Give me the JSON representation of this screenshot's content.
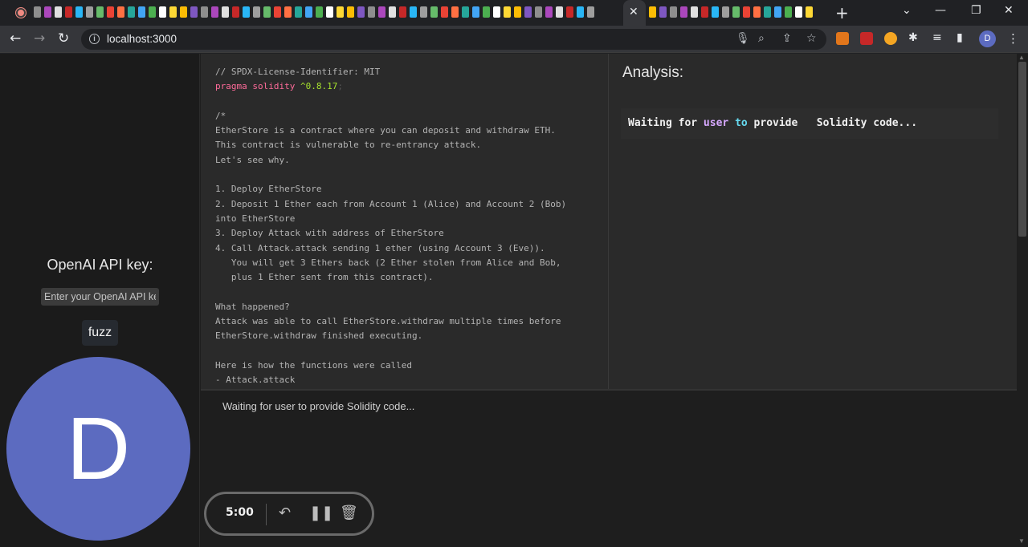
{
  "browser": {
    "url": "localhost:3000",
    "profile_initial": "D"
  },
  "sidebar": {
    "api_label": "OpenAI API key:",
    "api_placeholder": "Enter your OpenAI API key",
    "fuzz_label": "fuzz",
    "avatar_initial": "D"
  },
  "code": {
    "lines": [
      "// SPDX-License-Identifier: MIT",
      "__PRAGMA__",
      "",
      "/*",
      "EtherStore is a contract where you can deposit and withdraw ETH.",
      "This contract is vulnerable to re-entrancy attack.",
      "Let's see why.",
      "",
      "1. Deploy EtherStore",
      "2. Deposit 1 Ether each from Account 1 (Alice) and Account 2 (Bob)",
      "into EtherStore",
      "3. Deploy Attack with address of EtherStore",
      "4. Call Attack.attack sending 1 ether (using Account 3 (Eve)).",
      "   You will get 3 Ethers back (2 Ether stolen from Alice and Bob,",
      "   plus 1 Ether sent from this contract).",
      "",
      "What happened?",
      "Attack was able to call EtherStore.withdraw multiple times before",
      "EtherStore.withdraw finished executing.",
      "",
      "Here is how the functions were called",
      "- Attack.attack"
    ],
    "pragma_keyword": "pragma solidity",
    "pragma_version": "^0.8.17",
    "pragma_end": ";"
  },
  "analysis": {
    "title": "Analysis:",
    "w1": "Waiting for ",
    "w2": "user",
    "w3": " ",
    "w4": "to",
    "w5": " provide   Solidity code..."
  },
  "output": {
    "status": "Waiting for user to provide Solidity code..."
  },
  "timer": {
    "time": "5:00"
  },
  "colors": {
    "accent_avatar": "#5c6bc0",
    "keyword": "#ff6b9a",
    "version": "#a6e22e"
  }
}
